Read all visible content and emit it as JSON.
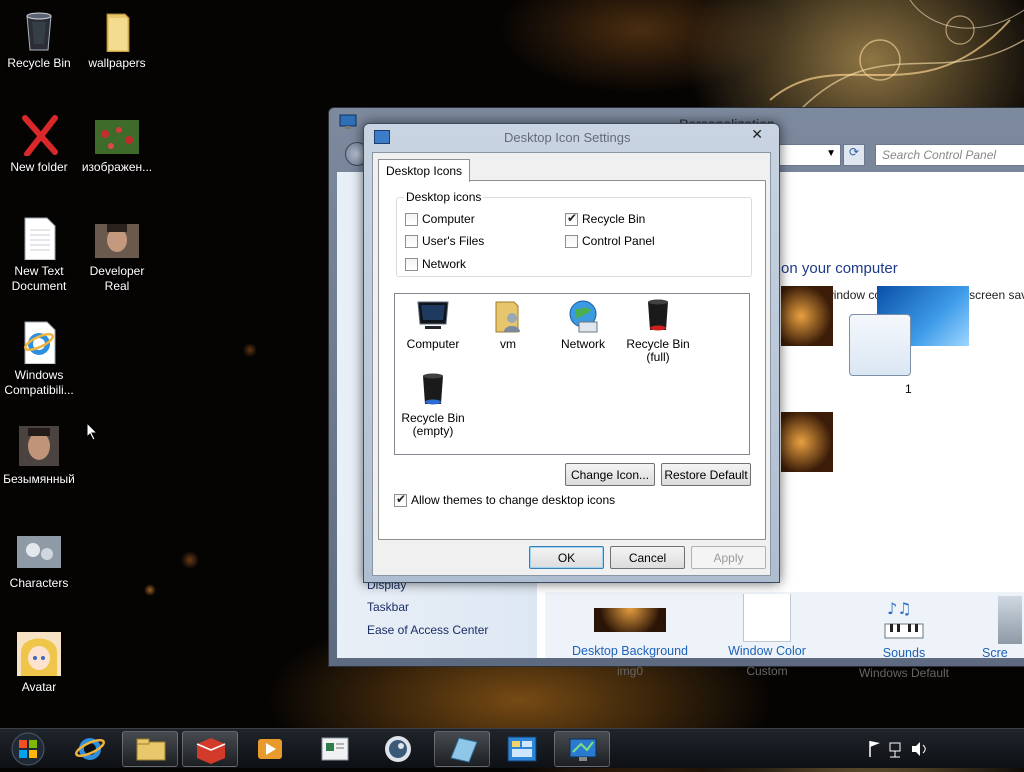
{
  "desktop": {
    "icons": [
      {
        "label": "Recycle Bin",
        "icon": "recycle-bin-icon"
      },
      {
        "label": "wallpapers",
        "icon": "folder-icon"
      },
      {
        "label": "New folder",
        "icon": "red-x-icon"
      },
      {
        "label": "изображен...",
        "icon": "image-thumbnail-icon"
      },
      {
        "label": "New Text Document",
        "icon": "text-document-icon"
      },
      {
        "label": "Developer Real",
        "icon": "photo-thumbnail-icon"
      },
      {
        "label": "Windows Compatibili...",
        "icon": "internet-explorer-icon"
      },
      {
        "label": "Безымянный",
        "icon": "photo-thumbnail-icon"
      },
      {
        "label": "Characters",
        "icon": "characters-icon"
      },
      {
        "label": "Avatar",
        "icon": "avatar-icon"
      }
    ]
  },
  "personalization": {
    "title": "Personalization",
    "search_placeholder": "Search Control Panel",
    "heading": "on your computer",
    "subtext": "ground, window color, sounds, and screen sav",
    "theme_number": "1",
    "see_also": [
      "Display",
      "Taskbar",
      "Ease of Access Center"
    ],
    "bottom_items": [
      {
        "title": "Desktop Background",
        "subtitle": "img0"
      },
      {
        "title": "Window Color",
        "subtitle": "Custom"
      },
      {
        "title": "Sounds",
        "subtitle": "Windows Default"
      },
      {
        "title": "Scre",
        "subtitle": ""
      }
    ]
  },
  "dialog": {
    "title": "Desktop Icon Settings",
    "close": "✕",
    "tab": "Desktop Icons",
    "group_title": "Desktop icons",
    "checkboxes": [
      {
        "label": "Computer",
        "checked": false
      },
      {
        "label": "Recycle Bin",
        "checked": true
      },
      {
        "label": "User's Files",
        "checked": false
      },
      {
        "label": "Control Panel",
        "checked": false
      },
      {
        "label": "Network",
        "checked": false
      }
    ],
    "icon_list": [
      {
        "label": "Computer",
        "icon": "monitor-icon"
      },
      {
        "label": "vm",
        "icon": "user-folder-icon"
      },
      {
        "label": "Network",
        "icon": "network-globe-icon"
      },
      {
        "label": "Recycle Bin (full)",
        "icon": "recycle-bin-full-icon"
      },
      {
        "label": "Recycle Bin (empty)",
        "icon": "recycle-bin-empty-icon"
      }
    ],
    "change_icon": "Change Icon...",
    "restore_default": "Restore Default",
    "allow_themes": "Allow themes to change desktop icons",
    "allow_themes_checked": true,
    "ok": "OK",
    "cancel": "Cancel",
    "apply": "Apply"
  },
  "taskbar": {
    "buttons": [
      "internet-explorer-icon",
      "explorer-folder-icon",
      "app-red-icon",
      "media-player-icon",
      "document-icon",
      "steam-icon",
      "notes-icon",
      "network-app-icon",
      "display-control-panel-icon"
    ]
  }
}
